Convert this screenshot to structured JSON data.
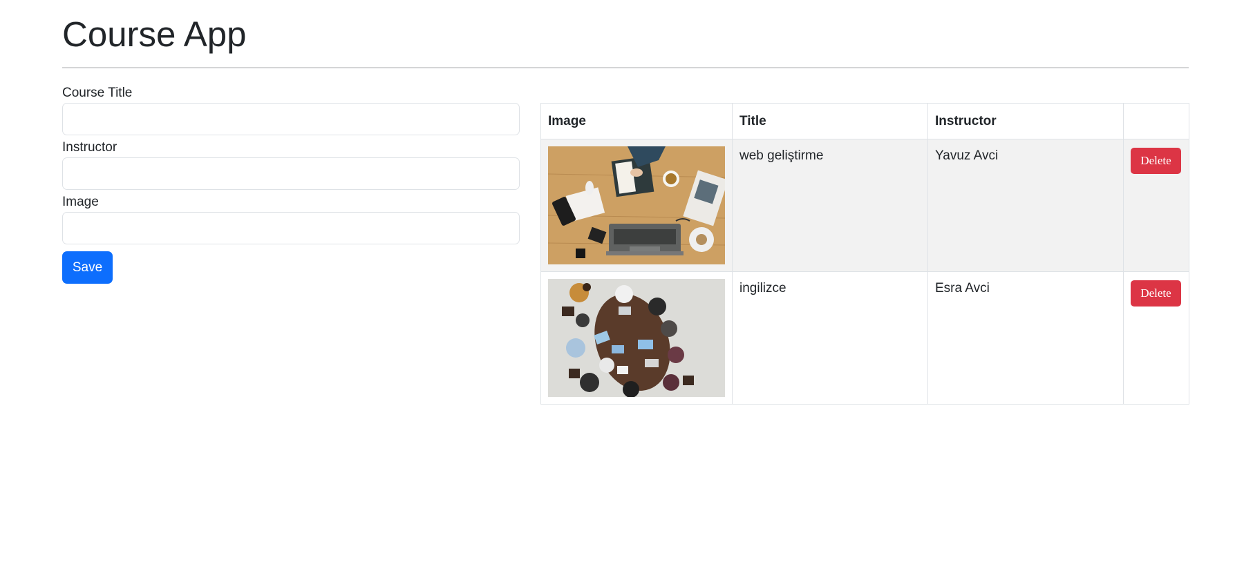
{
  "app": {
    "title": "Course App"
  },
  "form": {
    "fields": [
      {
        "label": "Course Title",
        "value": "",
        "placeholder": ""
      },
      {
        "label": "Instructor",
        "value": "",
        "placeholder": ""
      },
      {
        "label": "Image",
        "value": "",
        "placeholder": ""
      }
    ],
    "save_label": "Save",
    "save_color": "#0d6efd"
  },
  "table": {
    "columns": [
      "Image",
      "Title",
      "Instructor",
      ""
    ],
    "rows": [
      {
        "image_icon": "desk-laptop-photo",
        "title": "web geliştirme",
        "instructor": "Yavuz Avci",
        "delete_label": "Delete"
      },
      {
        "image_icon": "team-meeting-photo",
        "title": "ingilizce",
        "instructor": "Esra Avci",
        "delete_label": "Delete"
      }
    ],
    "delete_color": "#dc3545",
    "stripe_color": "#f2f2f2"
  }
}
